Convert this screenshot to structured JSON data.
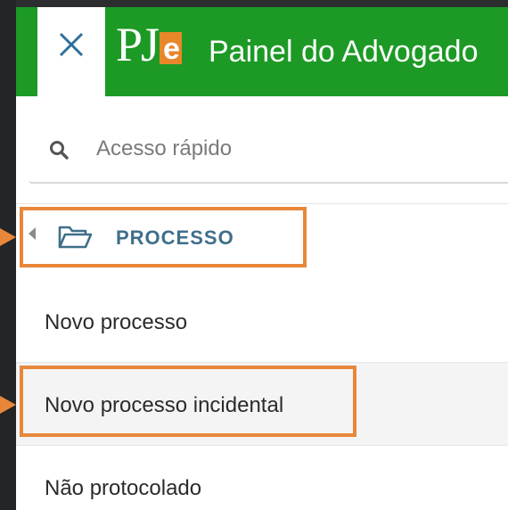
{
  "header": {
    "logo_text": "PJ",
    "logo_e": "e",
    "title": "Painel do Advogado"
  },
  "search": {
    "placeholder": "Acesso rápido"
  },
  "menu": {
    "group_label": "PROCESSO",
    "items": [
      {
        "label": "Novo processo"
      },
      {
        "label": "Novo processo incidental"
      },
      {
        "label": "Não protocolado"
      }
    ]
  },
  "colors": {
    "header_green": "#1c9a25",
    "highlight_orange": "#e8873a",
    "group_label_blue": "#3f6f8a"
  },
  "icons": [
    "close-icon",
    "search-icon",
    "caret-left-icon",
    "folder-open-icon"
  ]
}
